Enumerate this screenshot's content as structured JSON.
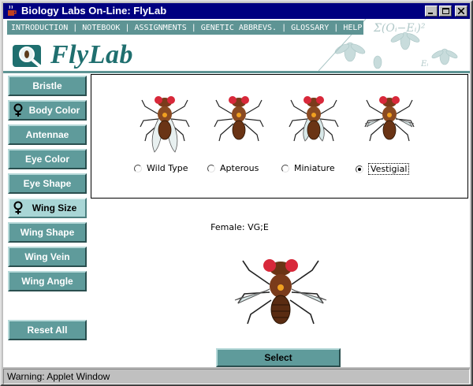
{
  "window": {
    "title": "Biology Labs On-Line: FlyLab"
  },
  "nav": {
    "items": [
      "INTRODUCTION",
      "NOTEBOOK",
      "ASSIGNMENTS",
      "GENETIC ABBREVS.",
      "GLOSSARY",
      "HELP"
    ]
  },
  "logo": {
    "text": "FlyLab"
  },
  "sidebar": {
    "items": [
      {
        "label": "Bristle"
      },
      {
        "label": "Body Color"
      },
      {
        "label": "Antennae"
      },
      {
        "label": "Eye Color"
      },
      {
        "label": "Eye Shape"
      },
      {
        "label": "Wing Size"
      },
      {
        "label": "Wing Shape"
      },
      {
        "label": "Wing Vein"
      },
      {
        "label": "Wing Angle"
      }
    ],
    "reset_label": "Reset All"
  },
  "phenotypes": {
    "options": [
      "Wild Type",
      "Apterous",
      "Miniature",
      "Vestigial"
    ],
    "selected": "Vestigial"
  },
  "result": {
    "label": "Female: VG;E"
  },
  "select_label": "Select",
  "status": {
    "text": "Warning: Applet Window"
  },
  "colors": {
    "accent": "#5f9b9b",
    "active": "#a9d6d6",
    "titlebar": "#000080"
  }
}
